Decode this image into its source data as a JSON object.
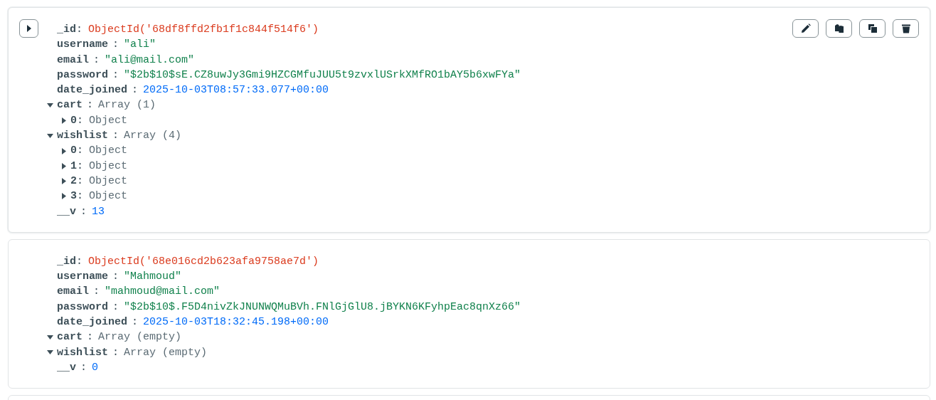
{
  "documents": [
    {
      "hovered": true,
      "fields": [
        {
          "key": "_id",
          "sep": ":",
          "kind": "objectid",
          "value": "ObjectId('68df8ffd2fb1f1c844f514f6')"
        },
        {
          "key": "username",
          "sep": ":",
          "kind": "string",
          "value": "\"ali\""
        },
        {
          "key": "email",
          "sep": ":",
          "kind": "string",
          "value": "\"ali@mail.com\""
        },
        {
          "key": "password",
          "sep": ":",
          "kind": "string",
          "value": "\"$2b$10$sE.CZ8uwJy3Gmi9HZCGMfuJUU5t9zvxlUSrkXMfRO1bAY5b6xwFYa\""
        },
        {
          "key": "date_joined",
          "sep": ":",
          "kind": "date",
          "value": "2025-10-03T08:57:33.077+00:00"
        },
        {
          "key": "cart",
          "sep": ":",
          "kind": "array",
          "value": "Array (1)",
          "expanded": true,
          "items": [
            {
              "key": "0",
              "sep": ":",
              "value": "Object",
              "expanded": false
            }
          ]
        },
        {
          "key": "wishlist",
          "sep": ":",
          "kind": "array",
          "value": "Array (4)",
          "expanded": true,
          "items": [
            {
              "key": "0",
              "sep": ":",
              "value": "Object",
              "expanded": false
            },
            {
              "key": "1",
              "sep": ":",
              "value": "Object",
              "expanded": false
            },
            {
              "key": "2",
              "sep": ":",
              "value": "Object",
              "expanded": false
            },
            {
              "key": "3",
              "sep": ":",
              "value": "Object",
              "expanded": false
            }
          ]
        },
        {
          "key": "__v",
          "sep": ":",
          "kind": "number",
          "value": "13"
        }
      ]
    },
    {
      "hovered": false,
      "fields": [
        {
          "key": "_id",
          "sep": ":",
          "kind": "objectid",
          "value": "ObjectId('68e016cd2b623afa9758ae7d')"
        },
        {
          "key": "username",
          "sep": ":",
          "kind": "string",
          "value": "\"Mahmoud\""
        },
        {
          "key": "email",
          "sep": ":",
          "kind": "string",
          "value": "\"mahmoud@mail.com\""
        },
        {
          "key": "password",
          "sep": ":",
          "kind": "string",
          "value": "\"$2b$10$.F5D4nivZkJNUNWQMuBVh.FNlGjGlU8.jBYKN6KFyhpEac8qnXz66\""
        },
        {
          "key": "date_joined",
          "sep": ":",
          "kind": "date",
          "value": "2025-10-03T18:32:45.198+00:00"
        },
        {
          "key": "cart",
          "sep": ":",
          "kind": "array",
          "value": "Array (empty)",
          "expanded": true
        },
        {
          "key": "wishlist",
          "sep": ":",
          "kind": "array",
          "value": "Array (empty)",
          "expanded": true
        },
        {
          "key": "__v",
          "sep": ":",
          "kind": "number",
          "value": "0"
        }
      ]
    },
    {
      "hovered": false
    }
  ]
}
